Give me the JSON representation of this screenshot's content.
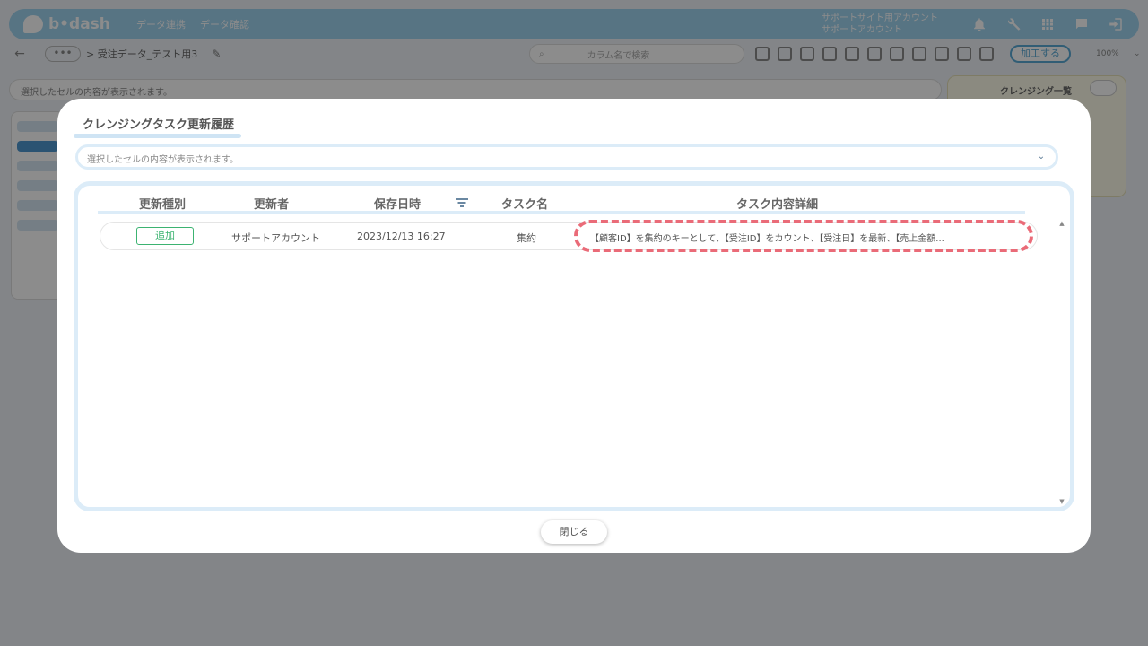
{
  "app": {
    "logo_text": "b•dash",
    "nav": [
      "データ連携",
      "データ確認"
    ],
    "account": {
      "line1": "サポートサイト用アカウント",
      "line2": "サポートアカウント"
    }
  },
  "toolbar": {
    "breadcrumb": "> 受注データ_テスト用3",
    "search_placeholder": "カラム名で検索",
    "process_button": "加工する",
    "zoom": "100%"
  },
  "background": {
    "cell_content_placeholder": "選択したセルの内容が表示されます。",
    "side_panel_title": "クレンジング一覧"
  },
  "dialog": {
    "title": "クレンジングタスク更新履歴",
    "cell_content_placeholder": "選択したセルの内容が表示されます。",
    "columns": [
      "更新種別",
      "更新者",
      "保存日時",
      "タスク名",
      "タスク内容詳細"
    ],
    "rows": [
      {
        "type": "追加",
        "user": "サポートアカウント",
        "saved_at": "2023/12/13 16:27",
        "task_name": "集約",
        "detail": "【顧客ID】を集約のキーとして、【受注ID】をカウント、【受注日】を最新、【売上金額..."
      }
    ],
    "close_label": "閉じる"
  },
  "colors": {
    "accent": "#5aa9d6",
    "badge_green": "#3cb371",
    "highlight_dash": "#ea6b78",
    "frame_blue": "#dcecf8"
  },
  "icons": [
    "bell-icon",
    "wrench-icon",
    "grid-icon",
    "chat-icon",
    "logout-icon",
    "search-icon",
    "filter-icon",
    "chevron-down-icon",
    "pencil-icon"
  ]
}
